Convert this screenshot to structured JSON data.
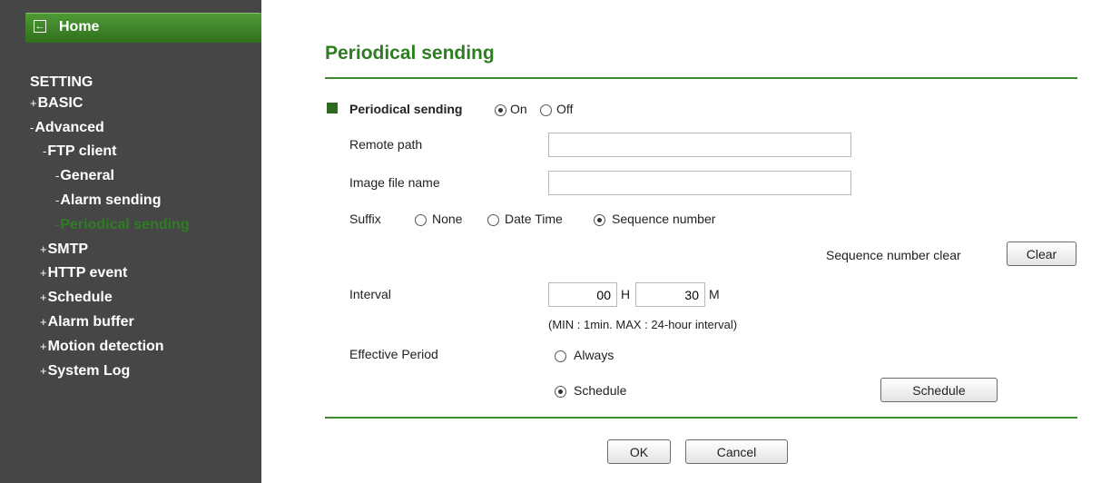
{
  "sidebar": {
    "home_label": "Home",
    "heading": "SETTING",
    "items": [
      {
        "prefix": "+",
        "label": "BASIC"
      },
      {
        "prefix": "-",
        "label": "Advanced"
      },
      {
        "prefix": "-",
        "label": "FTP client"
      },
      {
        "prefix": "-",
        "label": "General"
      },
      {
        "prefix": "-",
        "label": "Alarm sending"
      },
      {
        "prefix": "-",
        "label": "Periodical sending"
      },
      {
        "prefix": "+",
        "label": "SMTP"
      },
      {
        "prefix": "+",
        "label": "HTTP event"
      },
      {
        "prefix": "+",
        "label": "Schedule"
      },
      {
        "prefix": "+",
        "label": "Alarm buffer"
      },
      {
        "prefix": "+",
        "label": "Motion detection"
      },
      {
        "prefix": "+",
        "label": "System Log"
      }
    ]
  },
  "main": {
    "title": "Periodical sending",
    "periodical": {
      "label": "Periodical sending",
      "on": "On",
      "off": "Off",
      "selected": "On"
    },
    "remote_path": {
      "label": "Remote path",
      "value": ""
    },
    "image_file_name": {
      "label": "Image file name",
      "value": ""
    },
    "suffix": {
      "label": "Suffix",
      "options": [
        "None",
        "Date Time",
        "Sequence number"
      ],
      "selected": "Sequence number"
    },
    "sequence_clear": {
      "label": "Sequence number clear",
      "button": "Clear"
    },
    "interval": {
      "label": "Interval",
      "hours": "00",
      "hours_unit": "H",
      "minutes": "30",
      "minutes_unit": "M",
      "note": "(MIN : 1min. MAX : 24-hour interval)"
    },
    "effective_period": {
      "label": "Effective Period",
      "always": "Always",
      "schedule": "Schedule",
      "selected": "Schedule",
      "schedule_button": "Schedule"
    },
    "ok_button": "OK",
    "cancel_button": "Cancel"
  },
  "colors": {
    "accent": "#2e7d22",
    "sidebar_bg": "#464646",
    "home_bar": "#3f8a2a"
  }
}
